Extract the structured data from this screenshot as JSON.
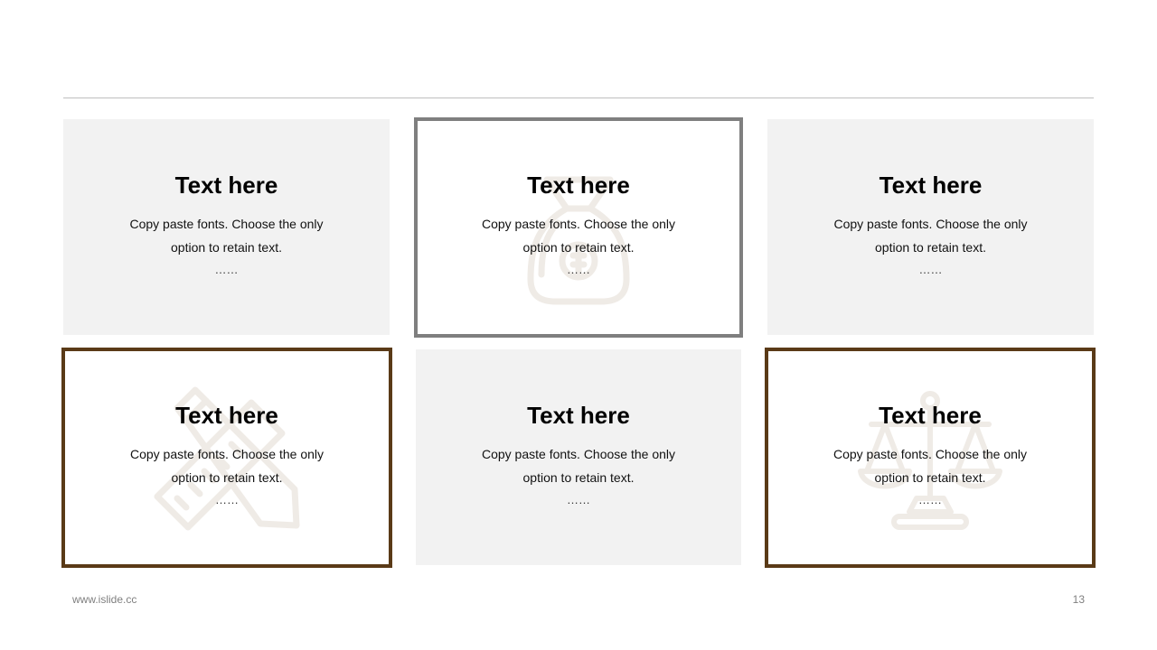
{
  "cards": [
    {
      "title": "Text here",
      "body": "Copy paste fonts. Choose the only option to retain text.",
      "dots": "……",
      "icon": "none"
    },
    {
      "title": "Text here",
      "body": "Copy paste fonts. Choose the only option to retain text.",
      "dots": "……",
      "icon": "money-bag-icon"
    },
    {
      "title": "Text here",
      "body": "Copy paste fonts. Choose the only option to retain text.",
      "dots": "……",
      "icon": "none"
    },
    {
      "title": "Text here",
      "body": "Copy paste fonts. Choose the only option to retain text.",
      "dots": "……",
      "icon": "ruler-pencil-icon"
    },
    {
      "title": "Text here",
      "body": "Copy paste fonts. Choose the only option to retain text.",
      "dots": "……",
      "icon": "none"
    },
    {
      "title": "Text here",
      "body": "Copy paste fonts. Choose the only option to retain text.",
      "dots": "……",
      "icon": "balance-scale-icon"
    }
  ],
  "footer": {
    "url": "www.islide.cc",
    "page_number": "13"
  },
  "colors": {
    "card_gray": "#f2f2f2",
    "border_gray": "#7f7f7f",
    "border_brown": "#5a3a17",
    "watermark": "#efebe6",
    "rule": "#bfbfbf"
  }
}
